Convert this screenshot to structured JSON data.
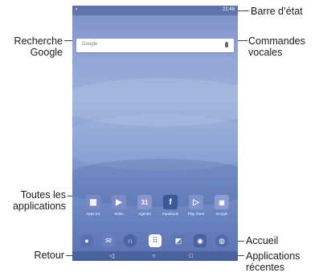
{
  "labels": {
    "status_bar": "Barre d’état",
    "google_search_line1": "Recherche",
    "google_search_line2": "Google",
    "voice_commands_line1": "Commandes",
    "voice_commands_line2": "vocales",
    "all_apps_line1": "Toutes les",
    "all_apps_line2": "applications",
    "back": "Retour",
    "home": "Accueil",
    "recent_apps_line1": "Applications",
    "recent_apps_line2": "récentes"
  },
  "screen": {
    "status_time": "21:46",
    "search_placeholder": "Google",
    "apps": [
      {
        "name": "Apps ES",
        "icon": "apps-es-icon",
        "color": "#7a88c4"
      },
      {
        "name": "Vidéo",
        "icon": "video-icon",
        "color": "#7d88c8"
      },
      {
        "name": "Agenda",
        "icon": "calendar-icon",
        "color": "#8a94cc"
      },
      {
        "name": "Facebook",
        "icon": "facebook-icon",
        "color": "#3b5998"
      },
      {
        "name": "Play Store",
        "icon": "play-store-icon",
        "color": "#7f92cf"
      },
      {
        "name": "Google",
        "icon": "google-folder-icon",
        "color": "#8c9bd4"
      }
    ],
    "dock": [
      {
        "icon": "contacts-icon",
        "color": "#5a6fb3"
      },
      {
        "icon": "email-icon",
        "color": "#6b7ec0"
      },
      {
        "icon": "headphones-icon",
        "color": "#4f62a8"
      },
      {
        "icon": "all-apps-icon",
        "color": "#ffffff"
      },
      {
        "icon": "gallery-icon",
        "color": "#5f74b6"
      },
      {
        "icon": "camera-icon",
        "color": "#4c5f9e"
      },
      {
        "icon": "browser-icon",
        "color": "#5468aa"
      }
    ],
    "nav": {
      "back_glyph": "◁",
      "home_glyph": "○",
      "recent_glyph": "□"
    }
  }
}
